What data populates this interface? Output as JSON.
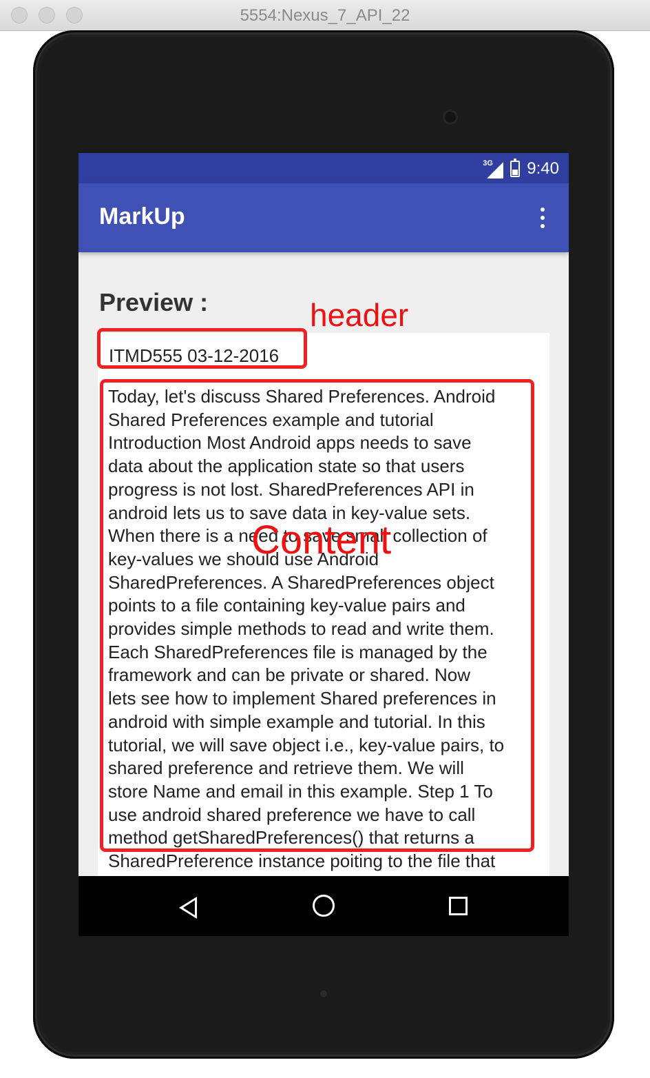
{
  "window": {
    "title": "5554:Nexus_7_API_22"
  },
  "status_bar": {
    "network": "3G",
    "time": "9:40"
  },
  "app_bar": {
    "title": "MarkUp",
    "menu_icon": "overflow-menu-icon"
  },
  "main": {
    "preview_label": "Preview :",
    "header_text": "ITMD555 03-12-2016",
    "content_lines": [
      "Today, let's discuss Shared Preferences. Android",
      "Shared Preferences example and tutorial",
      "Introduction Most Android apps needs to save",
      "data about the application state so that users",
      "progress is not lost. SharedPreferences API in",
      "android lets us to save data in key-value sets.",
      "When there is a need to save small collection of",
      "key-values we should use Android",
      "SharedPreferences. A SharedPreferences object",
      "points to a file containing key-value pairs and",
      "provides simple methods to read and write them.",
      "Each SharedPreferences file is managed by the",
      "framework and can be private or shared. Now",
      "lets see how to implement Shared preferences in",
      "android with simple example and tutorial. In this",
      "tutorial, we will save object i.e., key-value pairs, to",
      "shared preference and retrieve them. We will",
      "store Name and email in this example. Step 1 To",
      "use android shared preference we have to call",
      "method getSharedPreferences() that returns a",
      "SharedPreference instance poiting to the file that"
    ]
  },
  "nav_bar": {
    "back_icon": "back-icon",
    "home_icon": "home-icon",
    "recents_icon": "recents-icon"
  },
  "annotations": {
    "header_label": "header",
    "content_label": "Content",
    "color": "#ee2222"
  }
}
